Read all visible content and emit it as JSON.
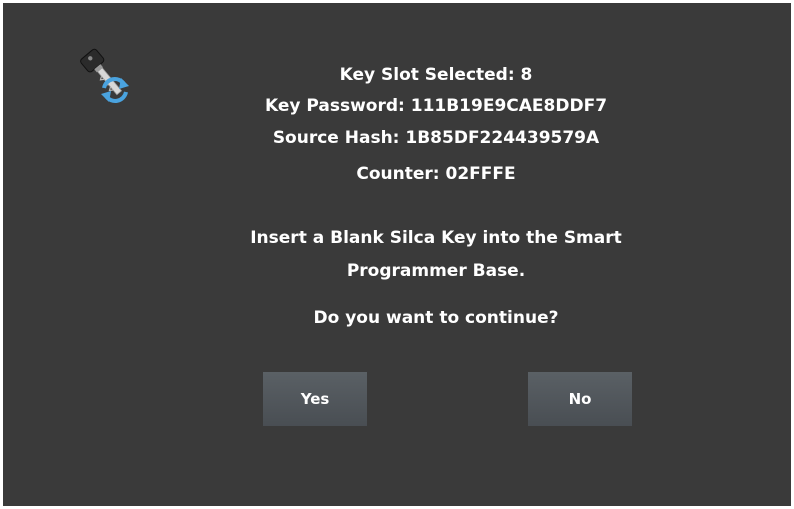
{
  "dialog": {
    "icon": "key-sync-icon",
    "key_slot": "Key Slot Selected: 8",
    "key_password": "Key Password: 111B19E9CAE8DDF7",
    "source_hash": "Source Hash: 1B85DF224439579A",
    "counter": "Counter: 02FFFE",
    "instruction_line1": "Insert a Blank Silca Key into the Smart",
    "instruction_line2": "Programmer Base.",
    "question": "Do you want to continue?"
  },
  "buttons": {
    "yes_label": "Yes",
    "no_label": "No"
  },
  "colors": {
    "background": "#3a3a3a",
    "button": "#52575c",
    "text": "#ffffff",
    "icon_blue": "#4aa3df"
  }
}
